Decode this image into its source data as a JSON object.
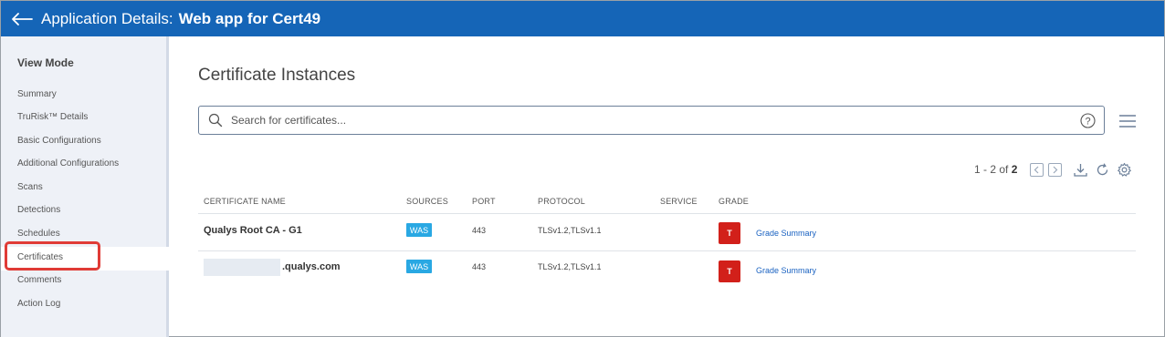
{
  "header": {
    "title_prefix": "Application Details:",
    "app_name": "Web app for Cert49",
    "back_icon": "arrow-left-icon",
    "background": "#1565b7"
  },
  "sidebar": {
    "section_title": "View Mode",
    "items": [
      {
        "label": "Summary"
      },
      {
        "label": "TruRisk™ Details"
      },
      {
        "label": "Basic Configurations"
      },
      {
        "label": "Additional Configurations"
      },
      {
        "label": "Scans"
      },
      {
        "label": "Detections"
      },
      {
        "label": "Schedules"
      },
      {
        "label": "Certificates"
      },
      {
        "label": "Comments"
      },
      {
        "label": "Action Log"
      }
    ],
    "active_item": "Certificates",
    "highlight_color": "#e03b36"
  },
  "main": {
    "title": "Certificate Instances",
    "search": {
      "placeholder": "Search for certificates...",
      "value": ""
    },
    "pagination": {
      "range": "1 - 2 of",
      "total": "2"
    },
    "table": {
      "columns": [
        "CERTIFICATE NAME",
        "SOURCES",
        "PORT",
        "PROTOCOL",
        "SERVICE",
        "GRADE"
      ],
      "rows": [
        {
          "name": "Qualys Root CA - G1",
          "source": "WAS",
          "port": "443",
          "protocol": "TLSv1.2,TLSv1.1",
          "service": "",
          "grade": "T",
          "link": "Grade Summary"
        },
        {
          "name": ".qualys.com",
          "source": "WAS",
          "port": "443",
          "protocol": "TLSv1.2,TLSv1.1",
          "service": "",
          "grade": "T",
          "link": "Grade Summary"
        }
      ]
    }
  },
  "colors": {
    "was_badge": "#29a8e3",
    "grade_badge": "#d2201a",
    "link": "#1a62c1"
  }
}
